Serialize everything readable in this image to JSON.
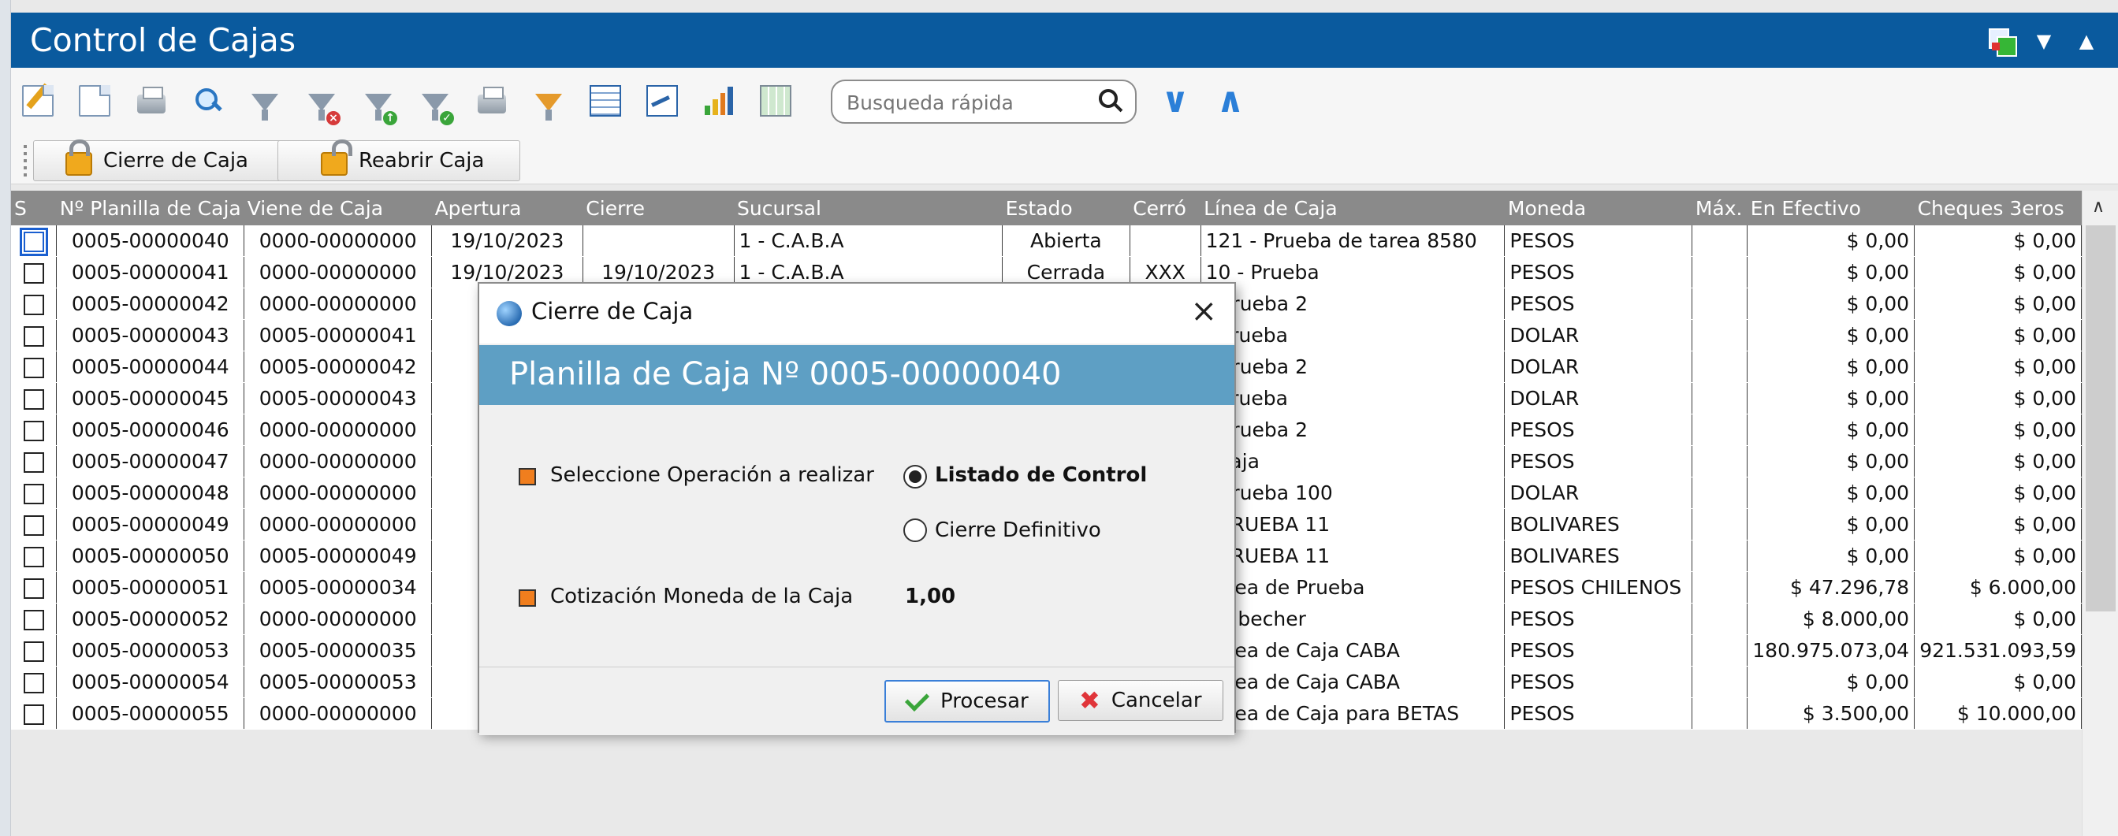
{
  "window": {
    "title": "Control de Cajas"
  },
  "search": {
    "placeholder": "Busqueda rápida"
  },
  "actions": {
    "close_box": "Cierre de Caja",
    "reopen_box": "Reabrir Caja"
  },
  "columns": [
    "S",
    "Nº Planilla de Caja",
    "Viene de Caja",
    "Apertura",
    "Cierre",
    "Sucursal",
    "Estado",
    "Cerró",
    "Línea de Caja",
    "Moneda",
    "Máx.",
    "En Efectivo",
    "Cheques 3eros"
  ],
  "rows": [
    {
      "planilla": "0005-00000040",
      "viene": "0000-00000000",
      "apertura": "19/10/2023",
      "cierre": "",
      "sucursal": "1 - C.A.B.A",
      "estado": "Abierta",
      "cerro": "",
      "linea": "121 - Prueba de tarea 8580",
      "moneda": "PESOS",
      "max": "",
      "efectivo": "$ 0,00",
      "cheques": "$ 0,00"
    },
    {
      "planilla": "0005-00000041",
      "viene": "0000-00000000",
      "apertura": "19/10/2023",
      "cierre": "19/10/2023",
      "sucursal": "1 - C.A.B.A",
      "estado": "Cerrada",
      "cerro": "XXX",
      "linea": "10 - Prueba",
      "moneda": "PESOS",
      "max": "",
      "efectivo": "$ 0,00",
      "cheques": "$ 0,00"
    },
    {
      "planilla": "0005-00000042",
      "viene": "0000-00000000",
      "apertura": "19/",
      "cierre": "",
      "sucursal": "",
      "estado": "",
      "cerro": "",
      "linea": "- prueba 2",
      "moneda": "PESOS",
      "max": "",
      "efectivo": "$ 0,00",
      "cheques": "$ 0,00"
    },
    {
      "planilla": "0005-00000043",
      "viene": "0005-00000041",
      "apertura": "19/",
      "cierre": "",
      "sucursal": "",
      "estado": "",
      "cerro": "",
      "linea": "- Prueba",
      "moneda": "DOLAR",
      "max": "",
      "efectivo": "$ 0,00",
      "cheques": "$ 0,00"
    },
    {
      "planilla": "0005-00000044",
      "viene": "0005-00000042",
      "apertura": "19/",
      "cierre": "",
      "sucursal": "",
      "estado": "",
      "cerro": "",
      "linea": "- prueba 2",
      "moneda": "DOLAR",
      "max": "",
      "efectivo": "$ 0,00",
      "cheques": "$ 0,00"
    },
    {
      "planilla": "0005-00000045",
      "viene": "0005-00000043",
      "apertura": "19/",
      "cierre": "",
      "sucursal": "",
      "estado": "",
      "cerro": "",
      "linea": "- Prueba",
      "moneda": "DOLAR",
      "max": "",
      "efectivo": "$ 0,00",
      "cheques": "$ 0,00"
    },
    {
      "planilla": "0005-00000046",
      "viene": "0000-00000000",
      "apertura": "19/",
      "cierre": "",
      "sucursal": "",
      "estado": "",
      "cerro": "",
      "linea": "- prueba 2",
      "moneda": "PESOS",
      "max": "",
      "efectivo": "$ 0,00",
      "cheques": "$ 0,00"
    },
    {
      "planilla": "0005-00000047",
      "viene": "0000-00000000",
      "apertura": "19/",
      "cierre": "",
      "sucursal": "",
      "estado": "",
      "cerro": "",
      "linea": "- caja",
      "moneda": "PESOS",
      "max": "",
      "efectivo": "$ 0,00",
      "cheques": "$ 0,00"
    },
    {
      "planilla": "0005-00000048",
      "viene": "0000-00000000",
      "apertura": "19/",
      "cierre": "",
      "sucursal": "",
      "estado": "",
      "cerro": "",
      "linea": "- prueba 100",
      "moneda": "DOLAR",
      "max": "",
      "efectivo": "$ 0,00",
      "cheques": "$ 0,00"
    },
    {
      "planilla": "0005-00000049",
      "viene": "0000-00000000",
      "apertura": "19/",
      "cierre": "",
      "sucursal": "",
      "estado": "",
      "cerro": "",
      "linea": "- PRUEBA 11",
      "moneda": "BOLIVARES",
      "max": "",
      "efectivo": "$ 0,00",
      "cheques": "$ 0,00"
    },
    {
      "planilla": "0005-00000050",
      "viene": "0005-00000049",
      "apertura": "19/",
      "cierre": "",
      "sucursal": "",
      "estado": "",
      "cerro": "",
      "linea": "- PRUEBA 11",
      "moneda": "BOLIVARES",
      "max": "",
      "efectivo": "$ 0,00",
      "cheques": "$ 0,00"
    },
    {
      "planilla": "0005-00000051",
      "viene": "0005-00000034",
      "apertura": "16/",
      "cierre": "",
      "sucursal": "",
      "estado": "",
      "cerro": "",
      "linea": "Linea de Prueba",
      "moneda": "PESOS CHILENOS",
      "max": "",
      "efectivo": "$ 47.296,78",
      "cheques": "$ 6.000,00"
    },
    {
      "planilla": "0005-00000052",
      "viene": "0000-00000000",
      "apertura": "29/",
      "cierre": "",
      "sucursal": "",
      "estado": "",
      "cerro": "",
      "linea": "2 - becher",
      "moneda": "PESOS",
      "max": "",
      "efectivo": "$ 8.000,00",
      "cheques": "$ 0,00"
    },
    {
      "planilla": "0005-00000053",
      "viene": "0005-00000035",
      "apertura": "28/",
      "cierre": "",
      "sucursal": "",
      "estado": "",
      "cerro": "",
      "linea": "Linea de Caja CABA",
      "moneda": "PESOS",
      "max": "",
      "efectivo": "180.975.073,04",
      "cheques": "921.531.093,59"
    },
    {
      "planilla": "0005-00000054",
      "viene": "0005-00000053",
      "apertura": "28/",
      "cierre": "",
      "sucursal": "",
      "estado": "",
      "cerro": "",
      "linea": "Linea de Caja CABA",
      "moneda": "PESOS",
      "max": "",
      "efectivo": "$ 0,00",
      "cheques": "$ 0,00"
    },
    {
      "planilla": "0005-00000055",
      "viene": "0000-00000000",
      "apertura": "26/",
      "cierre": "",
      "sucursal": "",
      "estado": "",
      "cerro": "",
      "linea": "Linea de Caja para BETAS",
      "moneda": "PESOS",
      "max": "",
      "efectivo": "$ 3.500,00",
      "cheques": "$ 10.000,00"
    }
  ],
  "dialog": {
    "title": "Cierre de Caja",
    "header": "Planilla de Caja Nº 0005-00000040",
    "operation_label": "Seleccione Operación a realizar",
    "options": [
      "Listado de Control",
      "Cierre Definitivo"
    ],
    "selected_option": "Listado de Control",
    "rate_label": "Cotización Moneda de la Caja",
    "rate_value": "1,00",
    "process_label": "Procesar",
    "cancel_label": "Cancelar"
  },
  "colors": {
    "titlebar": "#0a5a9e",
    "dialog_band": "#5e9fc4",
    "header_row": "#8a8a8a",
    "accent_blue": "#2b7fd8"
  }
}
